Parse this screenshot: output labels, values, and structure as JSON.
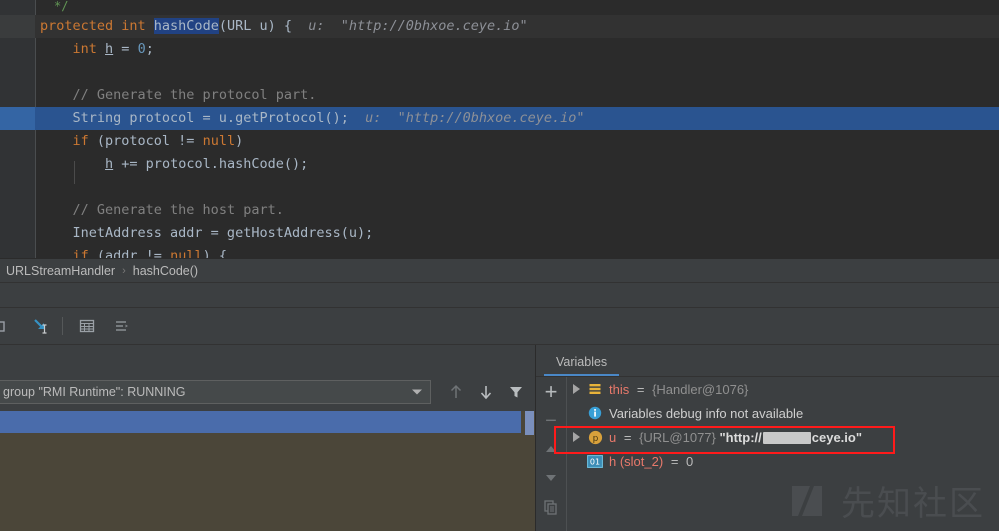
{
  "editor": {
    "lines": [
      {
        "id": "l0",
        "kind": "comment-tail",
        "text": "*/",
        "indent": 3
      },
      {
        "id": "l1",
        "kind": "method-decl",
        "highlight": "method",
        "segments": [
          {
            "t": "protected ",
            "c": "kw"
          },
          {
            "t": "int ",
            "c": "kw"
          },
          {
            "t": "hashCode",
            "c": "sel"
          },
          {
            "t": "(URL u) {",
            "c": ""
          }
        ],
        "hint": "u:  \"http://0bhxoe.ceye.io\""
      },
      {
        "id": "l2",
        "kind": "code",
        "segments": [
          {
            "t": "    ",
            "c": ""
          },
          {
            "t": "int ",
            "c": "kw"
          },
          {
            "t": "h",
            "c": "underl"
          },
          {
            "t": " = ",
            "c": ""
          },
          {
            "t": "0",
            "c": "num"
          },
          {
            "t": ";",
            "c": ""
          }
        ]
      },
      {
        "id": "l3",
        "kind": "blank",
        "segments": []
      },
      {
        "id": "l4",
        "kind": "code",
        "segments": [
          {
            "t": "    ",
            "c": ""
          },
          {
            "t": "// Generate the protocol part.",
            "c": "cmt"
          }
        ]
      },
      {
        "id": "l5",
        "kind": "code",
        "highlight": "exec",
        "segments": [
          {
            "t": "    String protocol = u.getProtocol();",
            "c": ""
          }
        ],
        "hint": "u:  \"http://0bhxoe.ceye.io\""
      },
      {
        "id": "l6",
        "kind": "code",
        "segments": [
          {
            "t": "    ",
            "c": ""
          },
          {
            "t": "if ",
            "c": "kw"
          },
          {
            "t": "(protocol != ",
            "c": ""
          },
          {
            "t": "null",
            "c": "kw"
          },
          {
            "t": ")",
            "c": ""
          }
        ]
      },
      {
        "id": "l7",
        "kind": "code",
        "segments": [
          {
            "t": "        ",
            "c": ""
          },
          {
            "t": "h",
            "c": "underl"
          },
          {
            "t": " += protocol.hashCode();",
            "c": ""
          }
        ]
      },
      {
        "id": "l8",
        "kind": "blank",
        "segments": []
      },
      {
        "id": "l9",
        "kind": "code",
        "segments": [
          {
            "t": "    ",
            "c": ""
          },
          {
            "t": "// Generate the host part.",
            "c": "cmt"
          }
        ]
      },
      {
        "id": "l10",
        "kind": "code",
        "segments": [
          {
            "t": "    InetAddress addr = getHostAddress(u);",
            "c": ""
          }
        ]
      },
      {
        "id": "l11",
        "kind": "code",
        "segments": [
          {
            "t": "    ",
            "c": ""
          },
          {
            "t": "if ",
            "c": "kw"
          },
          {
            "t": "(addr != ",
            "c": ""
          },
          {
            "t": "null",
            "c": "kw"
          },
          {
            "t": ") {",
            "c": ""
          }
        ]
      }
    ]
  },
  "breadcrumb": {
    "class_name": "URLStreamHandler",
    "separator": "›",
    "method_name": "hashCode()"
  },
  "debug_toolbar": {
    "icons": [
      {
        "name": "step-out-icon",
        "label": "Step Out"
      },
      {
        "name": "force-step-into-icon",
        "label": "Force Step Into"
      },
      {
        "name": "evaluate-expression-icon",
        "label": "Evaluate Expression"
      },
      {
        "name": "layout-settings-icon",
        "label": "Layout Settings"
      }
    ]
  },
  "frames": {
    "thread_selector_value": "group \"RMI Runtime\": RUNNING",
    "buttons": [
      {
        "name": "frame-up-button",
        "glyph": "↑"
      },
      {
        "name": "frame-down-button",
        "glyph": "↓"
      },
      {
        "name": "filter-frames-button",
        "glyph": "filter"
      }
    ]
  },
  "variables": {
    "tab_label": "Variables",
    "side_buttons": [
      {
        "name": "add-watch-button",
        "glyph": "+"
      },
      {
        "name": "remove-watch-button",
        "glyph": "−"
      },
      {
        "name": "move-watch-up-button",
        "glyph": "▲"
      },
      {
        "name": "move-watch-down-button",
        "glyph": "▼"
      },
      {
        "name": "copy-value-button",
        "glyph": "copy"
      }
    ],
    "rows": [
      {
        "id": "v-this",
        "expandable": true,
        "icon": "object-field-icon",
        "icon_kind": "stack",
        "name": "this",
        "eq": "=",
        "ref": "{Handler@1076}",
        "value": "",
        "redacted": false,
        "highlighted": false
      },
      {
        "id": "v-info",
        "expandable": false,
        "icon": "info-icon",
        "icon_kind": "info",
        "name": "",
        "eq": "",
        "ref": "",
        "info_text": "Variables debug info not available",
        "value": "",
        "redacted": false,
        "highlighted": false
      },
      {
        "id": "v-u",
        "expandable": true,
        "icon": "parameter-icon",
        "icon_kind": "param",
        "name": "u",
        "eq": "=",
        "ref": "{URL@1077}",
        "value_prefix": "\"http://",
        "value_suffix": "ceye.io\"",
        "redacted": true,
        "highlighted": true
      },
      {
        "id": "v-h",
        "expandable": false,
        "icon": "primitive-value-icon",
        "icon_kind": "primitive",
        "icon_text": "01",
        "name": "h (slot_2)",
        "eq": "=",
        "ref": "",
        "value": "0",
        "redacted": false,
        "highlighted": false
      }
    ]
  },
  "watermark": {
    "text": "先知社区"
  },
  "colors": {
    "editor_bg": "#2b2b2b",
    "panel_bg": "#3c3f41",
    "exec_line": "#2a5490",
    "selected_frame": "#4a6cab",
    "frames_bg": "#4b4639",
    "accent_red": "#ff1a1a",
    "tab_underline": "#4a88c7",
    "keyword": "#cc7832",
    "comment": "#808080",
    "number": "#6897bb",
    "var_name": "#e8796b"
  }
}
